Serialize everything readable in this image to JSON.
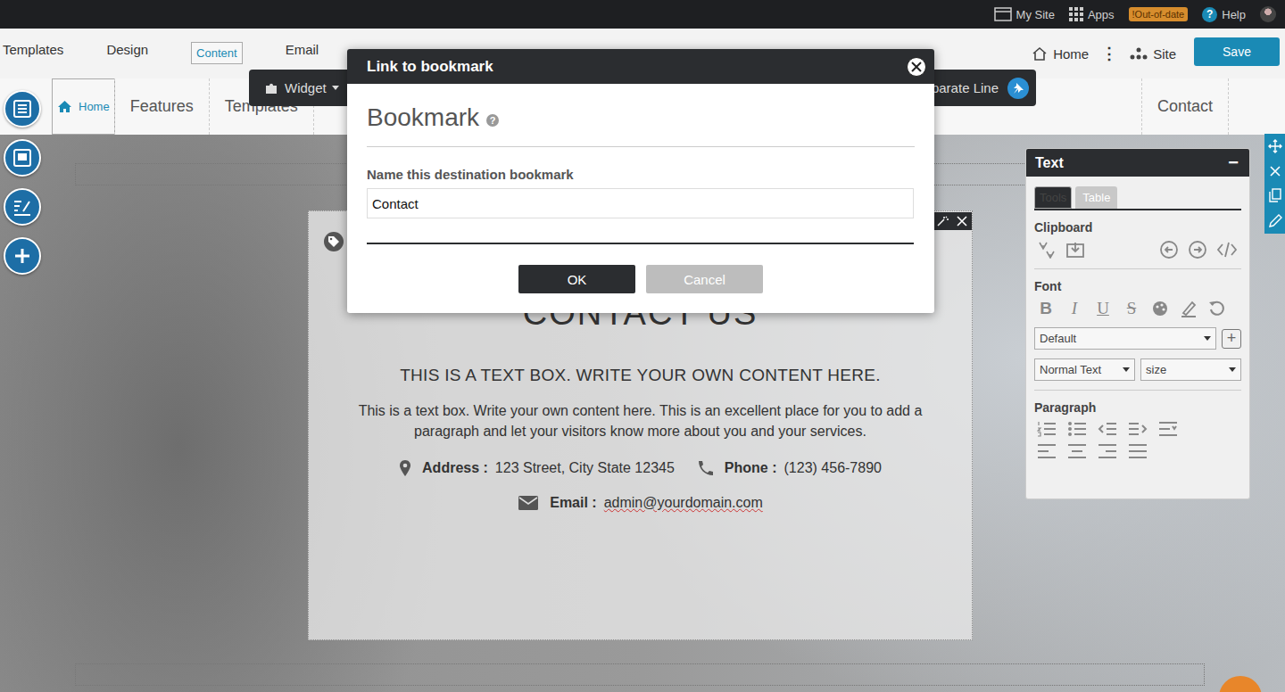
{
  "topbar": {
    "items": [
      {
        "label": "My Site",
        "kind": "link"
      },
      {
        "label": "Apps",
        "kind": "link"
      },
      {
        "label": "!Out-of-date",
        "kind": "badge"
      },
      {
        "label": "Help",
        "kind": "help"
      }
    ],
    "help_glyph": "?"
  },
  "editor_tabs": [
    {
      "label": "Templates",
      "selected": false
    },
    {
      "label": "Design",
      "selected": false
    },
    {
      "label": "Content",
      "selected": true
    },
    {
      "label": "Email",
      "selected": false
    }
  ],
  "editor_right": {
    "home": "Home",
    "menu": "⋮",
    "site": "Site",
    "save": "Save"
  },
  "floating_toolbar": {
    "widget": "Widget",
    "separate_line": "parate Line"
  },
  "site_nav": [
    {
      "label": "Home",
      "selected": true
    },
    {
      "label": "Features",
      "selected": false
    },
    {
      "label": "Templates",
      "selected": false
    },
    {
      "label": "Contact",
      "selected": false
    }
  ],
  "content": {
    "heading": "CONTACT US",
    "subheading": "THIS IS A TEXT BOX. WRITE YOUR OWN CONTENT HERE.",
    "paragraph": "This is a text box. Write your own content here. This is an excellent place for you to add a paragraph and let your visitors know more about you and your services.",
    "contact_rows": [
      [
        {
          "label": "Address :",
          "value": "123 Street, City State 12345",
          "kind": "address"
        },
        {
          "label": "Phone :",
          "value": "(123) 456-7890",
          "kind": "phone"
        }
      ],
      [
        {
          "label": "Email :",
          "value": "admin@yourdomain.com",
          "kind": "email"
        }
      ]
    ]
  },
  "text_panel": {
    "title": "Text",
    "collapse": "−",
    "tabs": [
      {
        "label": "Tools",
        "selected": true
      },
      {
        "label": "Table",
        "selected": false
      }
    ],
    "clipboard": "Clipboard",
    "font": "Font",
    "font_letters": [
      "B",
      "I",
      "U",
      "S"
    ],
    "font_family": "Default",
    "add": "+",
    "style": "Normal Text",
    "size": "size",
    "paragraph": "Paragraph"
  },
  "dialog": {
    "title": "Link to bookmark",
    "heading": "Bookmark",
    "help": "?",
    "label": "Name this destination bookmark",
    "value": "Contact",
    "buttons": [
      {
        "label": "OK",
        "kind": "primary"
      },
      {
        "label": "Cancel",
        "kind": "secondary"
      }
    ]
  }
}
